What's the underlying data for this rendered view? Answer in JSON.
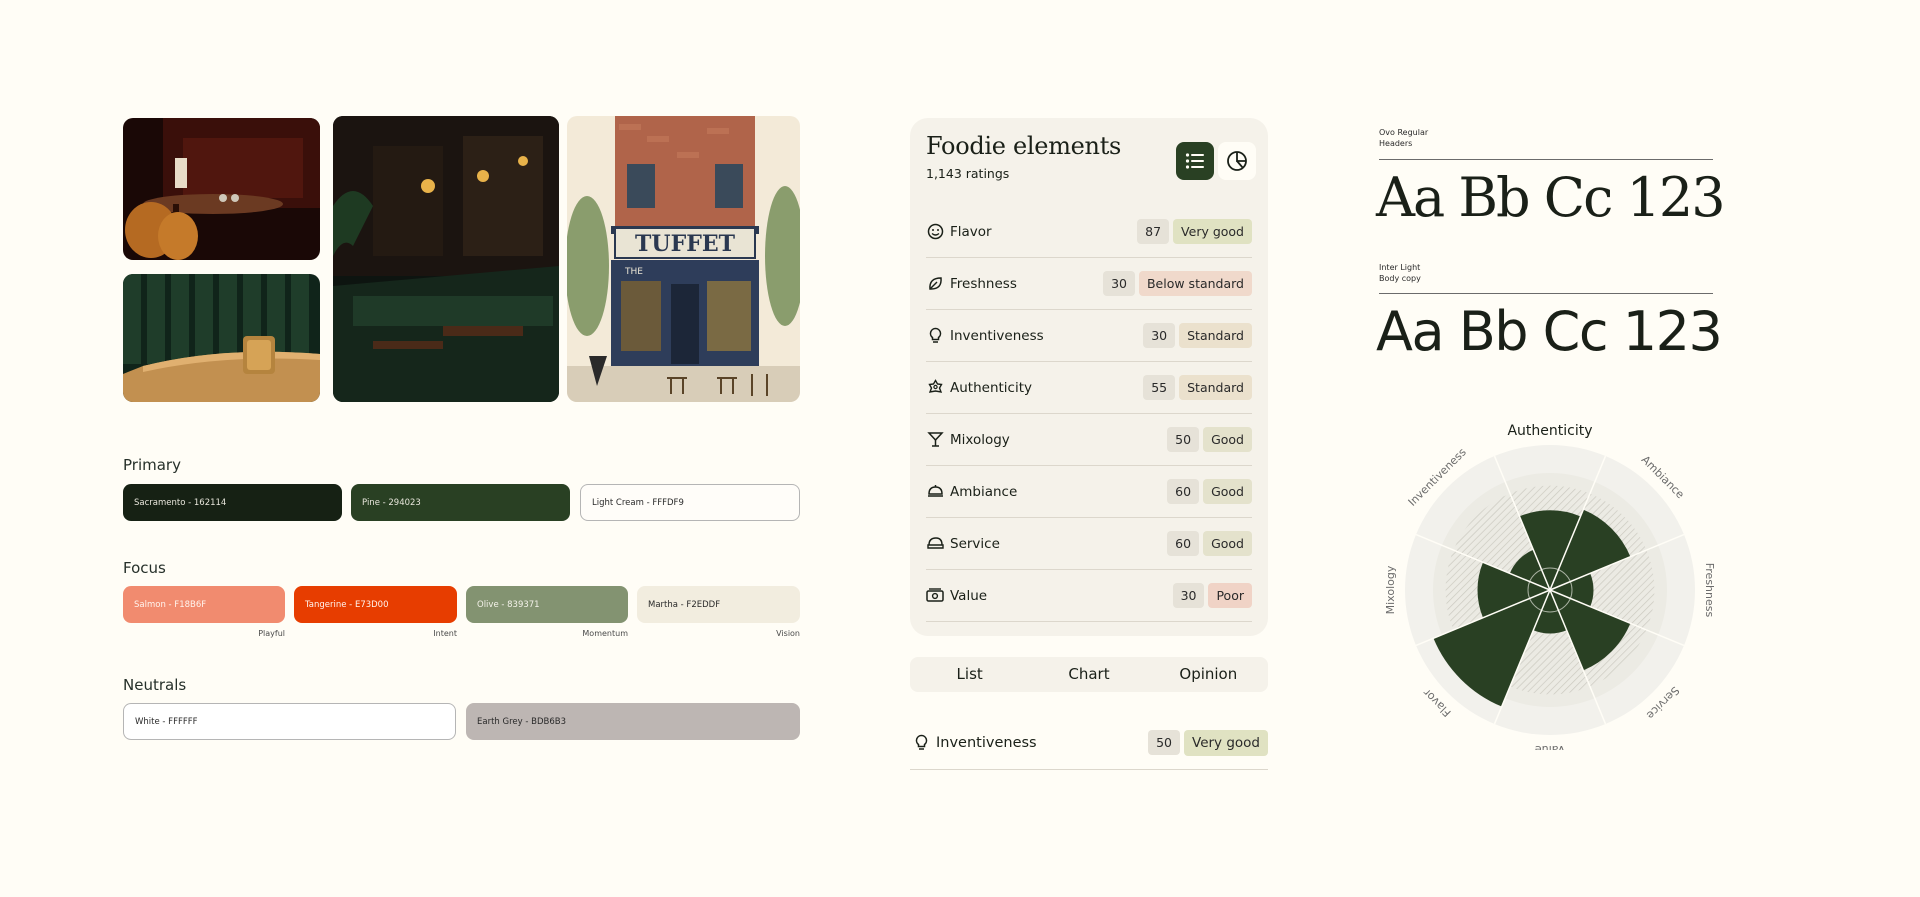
{
  "photos": [
    {
      "name": "dining-room-photo",
      "caption": ""
    },
    {
      "name": "green-booth-photo",
      "caption": ""
    },
    {
      "name": "bar-interior-photo",
      "caption": ""
    },
    {
      "name": "storefront-illustration",
      "sign": "TUFFET",
      "sign_small": "THE"
    }
  ],
  "palette": {
    "primary": {
      "title": "Primary",
      "swatches": [
        {
          "label": "Sacramento - 162114",
          "color": "#162114"
        },
        {
          "label": "Pine - 294023",
          "color": "#294023"
        },
        {
          "label": "Light Cream - FFFDF9",
          "color": "#FFFDF9"
        }
      ]
    },
    "focus": {
      "title": "Focus",
      "swatches": [
        {
          "label": "Salmon - F18B6F",
          "color": "#F18B6F",
          "note": "Playful"
        },
        {
          "label": "Tangerine - E73D00",
          "color": "#E73D00",
          "note": "Intent"
        },
        {
          "label": "Olive - 839371",
          "color": "#839371",
          "note": "Momentum"
        },
        {
          "label": "Martha - F2EDDF",
          "color": "#F2EDDF",
          "note": "Vision"
        }
      ]
    },
    "neutrals": {
      "title": "Neutrals",
      "swatches": [
        {
          "label": "White - FFFFFF",
          "color": "#FFFFFF"
        },
        {
          "label": "Earth Grey - BDB6B3",
          "color": "#BDB6B3"
        }
      ]
    }
  },
  "card": {
    "title": "Foodie elements",
    "subtitle": "1,143 ratings",
    "rows": [
      {
        "label": "Flavor",
        "icon": "smile-icon",
        "score": "87",
        "rating": "Very good",
        "badge_color": "#e0e2c2"
      },
      {
        "label": "Freshness",
        "icon": "leaf-icon",
        "score": "30",
        "rating": "Below standard",
        "badge_color": "#f0d9cb"
      },
      {
        "label": "Inventiveness",
        "icon": "lightbulb-icon",
        "score": "30",
        "rating": "Standard",
        "badge_color": "#ebe1cd"
      },
      {
        "label": "Authenticity",
        "icon": "badge-star-icon",
        "score": "55",
        "rating": "Standard",
        "badge_color": "#ebe1cd"
      },
      {
        "label": "Mixology",
        "icon": "cocktail-icon",
        "score": "50",
        "rating": "Good",
        "badge_color": "#e4e2cc"
      },
      {
        "label": "Ambiance",
        "icon": "cloche-icon",
        "score": "60",
        "rating": "Good",
        "badge_color": "#e4e2cc"
      },
      {
        "label": "Service",
        "icon": "service-icon",
        "score": "60",
        "rating": "Good",
        "badge_color": "#e4e2cc"
      },
      {
        "label": "Value",
        "icon": "cash-icon",
        "score": "30",
        "rating": "Poor",
        "badge_color": "#f0d3c6"
      }
    ]
  },
  "tabs": [
    "List",
    "Chart",
    "Opinion"
  ],
  "single": {
    "label": "Inventiveness",
    "icon": "lightbulb-icon",
    "score": "50",
    "rating": "Very good",
    "badge_color": "#e0e2c2"
  },
  "typography": {
    "serif": {
      "name": "Ovo Regular",
      "use": "Headers",
      "sample": "Aa Bb Cc 123"
    },
    "sans": {
      "name": "Inter Light",
      "use": "Body copy",
      "sample": "Aa Bb Cc 123"
    }
  },
  "chart_data": {
    "type": "radar",
    "categories": [
      "Authenticity",
      "Ambiance",
      "Freshness",
      "Service",
      "Value",
      "Flavor",
      "Mixology",
      "Inventiveness"
    ],
    "values": [
      55,
      60,
      30,
      60,
      30,
      87,
      50,
      30
    ],
    "ylim": [
      0,
      100
    ],
    "colors": {
      "fill": "#294023",
      "track": "#ecebe4"
    }
  }
}
